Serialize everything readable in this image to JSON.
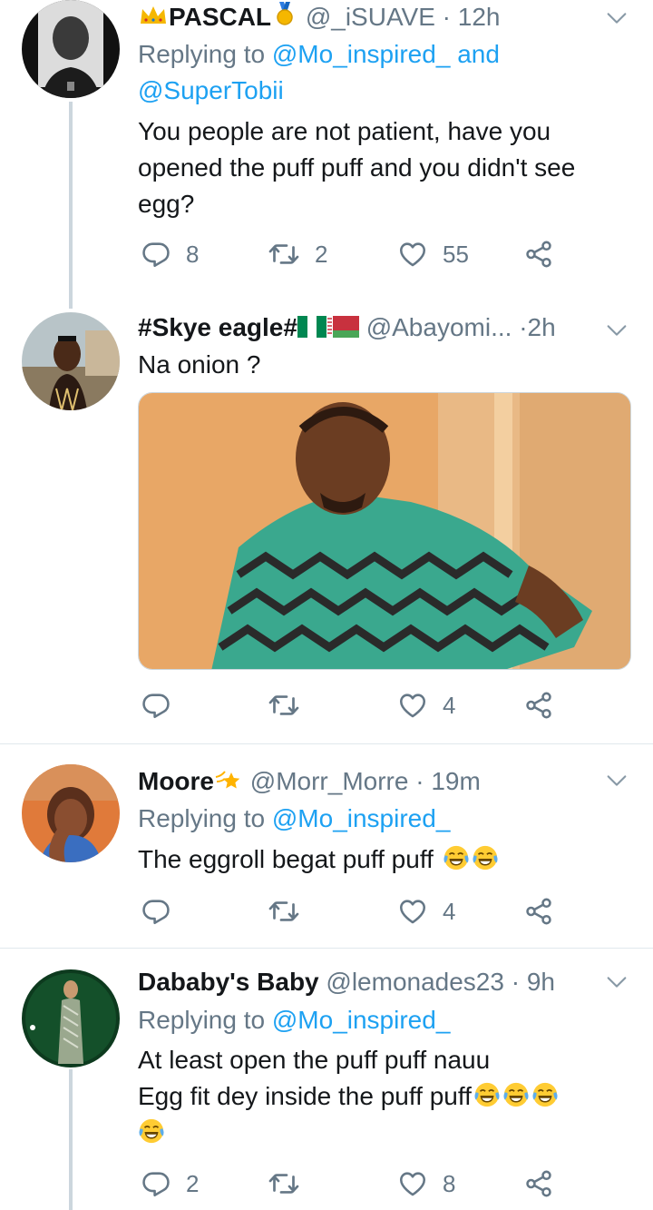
{
  "tweets": [
    {
      "name": "PASCAL",
      "handle": "@_iSUAVE",
      "time": "12h",
      "replying_prefix": "Replying to",
      "replying_to_1": "@Mo_inspired_",
      "replying_and": "and",
      "replying_to_2": "@SuperTobii",
      "text_lines": [
        "You people are not patient, have you",
        "opened the puff puff and you didn't see",
        "egg?"
      ],
      "replies": "8",
      "retweets": "2",
      "likes": "55"
    },
    {
      "name": "#Skye eagle#",
      "handle": "@Abayomi...",
      "time": "2h",
      "text_lines": [
        "Na onion ?"
      ],
      "replies": "",
      "retweets": "",
      "likes": "4"
    },
    {
      "name": "Moore",
      "handle": "@Morr_Morre",
      "time": "19m",
      "replying_prefix": "Replying to",
      "replying_to_1": "@Mo_inspired_",
      "text_lines": [
        "The eggroll begat puff puff"
      ],
      "replies": "",
      "retweets": "",
      "likes": "4"
    },
    {
      "name": "Dababy's Baby",
      "handle": "@lemonades23",
      "time": "9h",
      "replying_prefix": "Replying to",
      "replying_to_1": "@Mo_inspired_",
      "text_lines": [
        "At least open the puff puff nauu",
        "Egg fit dey inside the puff puff"
      ],
      "replies": "2",
      "retweets": "",
      "likes": "8"
    }
  ],
  "sep": "·",
  "icons": [
    "crown-icon",
    "medal-icon",
    "nigeria-flag-icon",
    "belarus-flag-icon",
    "sparkle-star-icon",
    "tears-of-joy-emoji",
    "reply-icon",
    "retweet-icon",
    "like-icon",
    "share-icon",
    "chevron-down-icon"
  ],
  "colors": {
    "link": "#1da1f2",
    "muted": "#657786",
    "divider": "#e1e8ed",
    "thread": "#ccd6dd"
  }
}
